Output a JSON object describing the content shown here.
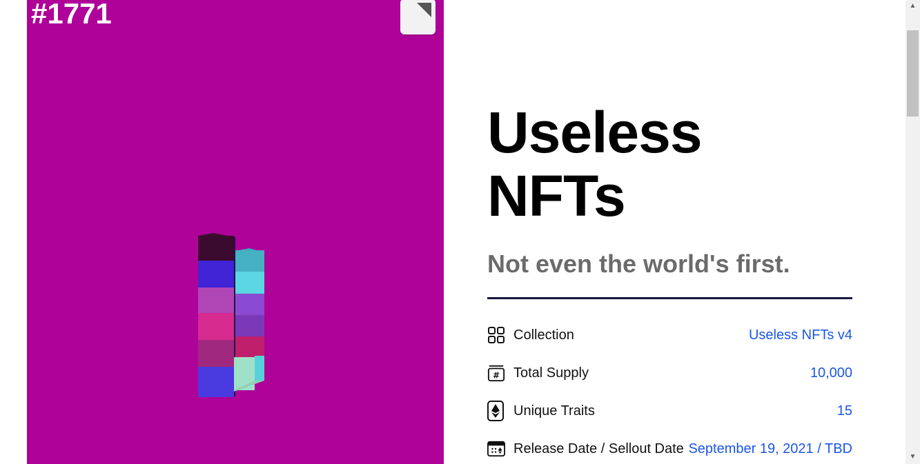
{
  "artwork": {
    "token_id": "#1771",
    "background_color": "#ae0299"
  },
  "hero": {
    "title": "Useless NFTs",
    "subtitle": "Not even the world's first."
  },
  "details": [
    {
      "icon": "grid-icon",
      "label": "Collection",
      "value": "Useless NFTs v4"
    },
    {
      "icon": "hash-icon",
      "label": "Total Supply",
      "value": "10,000"
    },
    {
      "icon": "ethereum-icon",
      "label": "Unique Traits",
      "value": "15"
    },
    {
      "icon": "calendar-icon",
      "label": "Release Date / Sellout Date",
      "value": "September 19, 2021 / TBD"
    }
  ],
  "colors": {
    "accent_link": "#1a56e6",
    "rule": "#14143a",
    "subtitle": "#6b6b6b"
  }
}
